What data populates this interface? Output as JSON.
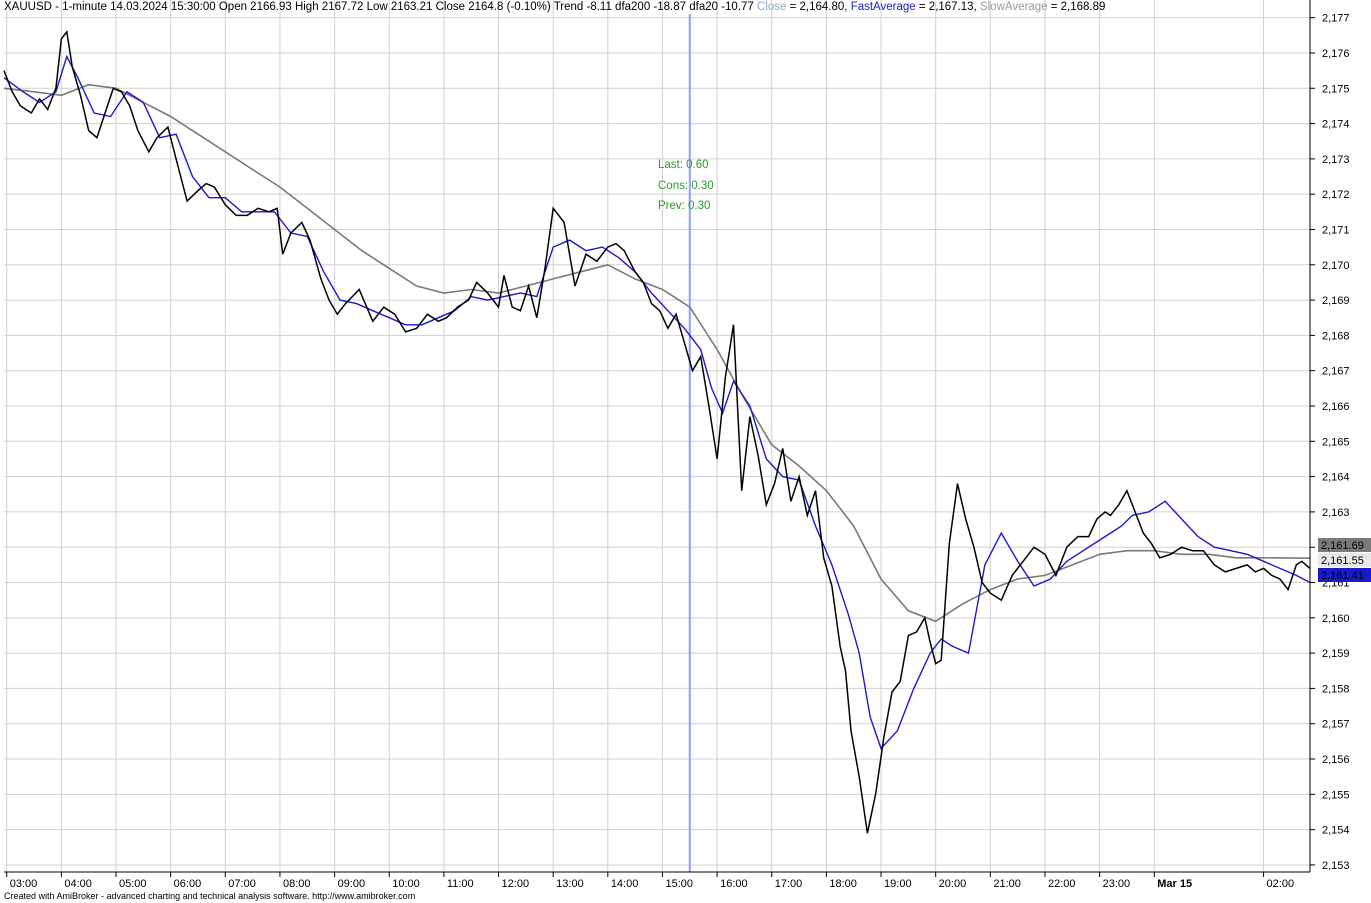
{
  "header": {
    "symbol": "XAUUSD",
    "sep": " - ",
    "timeframe": "1-minute",
    "datetime": "14.03.2024 15:30:00",
    "ohlc": "Open 2166.93 High 2167.72 Low 2163.21 Close 2164.8 (-0.10%)",
    "trend": "Trend -8.11 dfa200 -18.87 dfa20 -10.77",
    "close_label": "Close",
    "close_value": " = 2,164.80, ",
    "fast_label": "FastAverage",
    "fast_value": " = 2,167.13, ",
    "slow_label": "SlowAverage",
    "slow_value": " = 2,168.89"
  },
  "annotation": {
    "last": "Last: 0.60",
    "cons": "Cons: 0.30",
    "prev": "Prev: 0.30"
  },
  "footer": "Created with AmiBroker - advanced charting and technical analysis software. http://www.amibroker.com",
  "colors": {
    "price": "#000000",
    "fast_average": "#1a1acd",
    "slow_average": "#7a7a7a",
    "cursor": "#8f9dff",
    "grid": "#d0d0d0",
    "annotation": "#2c9a2c"
  },
  "chart_data": {
    "type": "line",
    "symbol": "XAUUSD",
    "interval": "1-minute",
    "ylim": [
      2152.8,
      2177.5
    ],
    "y_ticks": [
      2177,
      2176,
      2175,
      2174,
      2173,
      2172,
      2171,
      2170,
      2169,
      2168,
      2167,
      2166,
      2165,
      2164,
      2163,
      2162,
      2161,
      2160,
      2159,
      2158,
      2157,
      2156,
      2155,
      2154,
      2153
    ],
    "y_tick_labels": [
      "2,177",
      "2,176",
      "2,175",
      "2,174",
      "2,173",
      "2,172",
      "2,171",
      "2,170",
      "2,169",
      "2,168",
      "2,167",
      "2,166",
      "2,165",
      "2,164",
      "2,163",
      "2,162",
      "2,161",
      "2,160",
      "2,159",
      "2,158",
      "2,157",
      "2,156",
      "2,155",
      "2,154",
      "2,153"
    ],
    "x_ticks": [
      "03:00",
      "04:00",
      "05:00",
      "06:00",
      "07:00",
      "08:00",
      "09:00",
      "10:00",
      "11:00",
      "12:00",
      "13:00",
      "14:00",
      "15:00",
      "16:00",
      "17:00",
      "18:00",
      "19:00",
      "20:00",
      "21:00",
      "22:00",
      "23:00",
      "Mar 15",
      "02:00"
    ],
    "x_tick_hours": [
      3,
      4,
      5,
      6,
      7,
      8,
      9,
      10,
      11,
      12,
      13,
      14,
      15,
      16,
      17,
      18,
      19,
      20,
      21,
      22,
      23,
      24,
      26
    ],
    "x_range_hours": [
      2.95,
      26.85
    ],
    "cursor_time_hours": 15.5,
    "last_values": [
      {
        "label": "2,161.69",
        "value": 2161.69,
        "color": "#7a7a7a"
      },
      {
        "label": "2,161.55",
        "value": 2161.55,
        "color": "#e8e8e8"
      },
      {
        "label": "2,161.41",
        "value": 2161.41,
        "color": "#1a1acd"
      }
    ],
    "series": [
      {
        "name": "Close",
        "hours": [
          2.95,
          3.1,
          3.25,
          3.45,
          3.6,
          3.75,
          3.9,
          4.0,
          4.1,
          4.2,
          4.35,
          4.5,
          4.65,
          4.8,
          4.95,
          5.1,
          5.25,
          5.4,
          5.6,
          5.75,
          5.95,
          6.1,
          6.3,
          6.5,
          6.65,
          6.8,
          7.0,
          7.2,
          7.4,
          7.6,
          7.8,
          7.95,
          8.05,
          8.2,
          8.4,
          8.55,
          8.75,
          8.9,
          9.05,
          9.2,
          9.45,
          9.7,
          9.9,
          10.1,
          10.3,
          10.5,
          10.7,
          10.9,
          11.05,
          11.25,
          11.45,
          11.6,
          11.8,
          12.0,
          12.1,
          12.25,
          12.4,
          12.55,
          12.7,
          12.85,
          13.0,
          13.2,
          13.4,
          13.6,
          13.8,
          14.0,
          14.15,
          14.3,
          14.5,
          14.65,
          14.8,
          14.95,
          15.1,
          15.25,
          15.4,
          15.55,
          15.7,
          15.85,
          16.0,
          16.15,
          16.3,
          16.45,
          16.6,
          16.75,
          16.9,
          17.05,
          17.2,
          17.35,
          17.5,
          17.65,
          17.8,
          17.95,
          18.1,
          18.25,
          18.35,
          18.45,
          18.6,
          18.75,
          18.9,
          19.05,
          19.2,
          19.35,
          19.5,
          19.65,
          19.8,
          19.9,
          20.0,
          20.1,
          20.25,
          20.4,
          20.55,
          20.7,
          20.85,
          21.0,
          21.2,
          21.4,
          21.6,
          21.8,
          22.0,
          22.2,
          22.4,
          22.6,
          22.8,
          22.95,
          23.1,
          23.2,
          23.35,
          23.5,
          23.65,
          23.8,
          23.95,
          24.1,
          24.3,
          24.5,
          24.7,
          24.9,
          25.1,
          25.3,
          25.5,
          25.7,
          25.85,
          26.0,
          26.15,
          26.3,
          26.45,
          26.6,
          26.7,
          26.85
        ],
        "values": [
          2175.5,
          2174.9,
          2174.5,
          2174.3,
          2174.7,
          2174.4,
          2175.0,
          2176.4,
          2176.6,
          2175.6,
          2174.8,
          2173.8,
          2173.6,
          2174.3,
          2175.0,
          2174.9,
          2174.5,
          2173.8,
          2173.2,
          2173.6,
          2173.9,
          2173.0,
          2171.8,
          2172.1,
          2172.3,
          2172.2,
          2171.7,
          2171.4,
          2171.4,
          2171.6,
          2171.5,
          2171.6,
          2170.3,
          2170.9,
          2171.2,
          2170.7,
          2169.6,
          2169.0,
          2168.6,
          2168.9,
          2169.3,
          2168.4,
          2168.8,
          2168.6,
          2168.1,
          2168.2,
          2168.6,
          2168.4,
          2168.5,
          2168.8,
          2169.0,
          2169.5,
          2169.2,
          2168.8,
          2169.7,
          2168.8,
          2168.7,
          2169.4,
          2168.5,
          2169.9,
          2171.6,
          2171.2,
          2169.4,
          2170.3,
          2170.1,
          2170.5,
          2170.6,
          2170.4,
          2169.8,
          2169.5,
          2168.9,
          2168.7,
          2168.2,
          2168.6,
          2167.8,
          2167.0,
          2167.4,
          2166.0,
          2164.5,
          2166.8,
          2168.3,
          2163.6,
          2165.7,
          2164.6,
          2163.2,
          2163.8,
          2164.8,
          2163.3,
          2164.0,
          2162.9,
          2163.6,
          2161.7,
          2160.9,
          2159.2,
          2158.5,
          2156.8,
          2155.5,
          2153.9,
          2155.0,
          2156.6,
          2157.9,
          2158.2,
          2159.5,
          2159.6,
          2160.0,
          2159.3,
          2158.7,
          2158.8,
          2162.1,
          2163.8,
          2162.8,
          2162.0,
          2161.0,
          2160.7,
          2160.5,
          2161.2,
          2161.6,
          2162.0,
          2161.8,
          2161.2,
          2162.0,
          2162.3,
          2162.3,
          2162.8,
          2163.0,
          2162.9,
          2163.2,
          2163.6,
          2163.0,
          2162.4,
          2162.1,
          2161.7,
          2161.8,
          2162.0,
          2161.9,
          2161.9,
          2161.5,
          2161.3,
          2161.4,
          2161.5,
          2161.3,
          2161.4,
          2161.2,
          2161.1,
          2160.8,
          2161.5,
          2161.6,
          2161.4
        ]
      },
      {
        "name": "FastAverage",
        "hours": [
          2.95,
          3.3,
          3.6,
          3.9,
          4.1,
          4.3,
          4.6,
          4.9,
          5.2,
          5.5,
          5.8,
          6.1,
          6.4,
          6.7,
          7.0,
          7.3,
          7.6,
          7.9,
          8.2,
          8.5,
          8.8,
          9.1,
          9.4,
          9.7,
          10.0,
          10.3,
          10.6,
          10.9,
          11.2,
          11.5,
          11.8,
          12.1,
          12.4,
          12.7,
          13.0,
          13.3,
          13.6,
          13.9,
          14.2,
          14.5,
          14.8,
          15.1,
          15.4,
          15.7,
          15.9,
          16.1,
          16.3,
          16.6,
          16.9,
          17.2,
          17.5,
          17.8,
          18.1,
          18.4,
          18.6,
          18.8,
          19.0,
          19.3,
          19.6,
          19.9,
          20.1,
          20.3,
          20.6,
          20.9,
          21.2,
          21.5,
          21.8,
          22.1,
          22.4,
          22.7,
          23.0,
          23.2,
          23.4,
          23.6,
          23.9,
          24.2,
          24.5,
          24.8,
          25.1,
          25.4,
          25.7,
          26.0,
          26.3,
          26.6,
          26.85
        ],
        "values": [
          2175.3,
          2174.9,
          2174.6,
          2174.9,
          2175.9,
          2175.3,
          2174.3,
          2174.2,
          2174.9,
          2174.6,
          2173.6,
          2173.7,
          2172.5,
          2171.9,
          2171.9,
          2171.5,
          2171.5,
          2171.5,
          2170.9,
          2170.8,
          2169.8,
          2169.0,
          2168.9,
          2168.7,
          2168.5,
          2168.3,
          2168.3,
          2168.5,
          2168.7,
          2169.1,
          2169.0,
          2169.1,
          2169.2,
          2169.1,
          2170.5,
          2170.7,
          2170.4,
          2170.5,
          2170.2,
          2169.8,
          2169.2,
          2168.7,
          2168.2,
          2167.6,
          2166.5,
          2165.8,
          2166.7,
          2166.0,
          2164.5,
          2164.0,
          2163.9,
          2162.6,
          2161.5,
          2160.1,
          2159.0,
          2157.2,
          2156.3,
          2156.8,
          2158.0,
          2159.0,
          2159.4,
          2159.2,
          2159.0,
          2161.5,
          2162.4,
          2161.6,
          2160.9,
          2161.1,
          2161.6,
          2161.9,
          2162.2,
          2162.4,
          2162.6,
          2162.9,
          2163.0,
          2163.3,
          2162.8,
          2162.3,
          2162.0,
          2161.9,
          2161.8,
          2161.6,
          2161.4,
          2161.2,
          2161.0,
          2161.41
        ]
      },
      {
        "name": "SlowAverage",
        "hours": [
          2.95,
          3.5,
          4.0,
          4.5,
          5.0,
          5.5,
          6.0,
          6.5,
          7.0,
          7.5,
          8.0,
          8.5,
          9.0,
          9.5,
          10.0,
          10.5,
          11.0,
          11.5,
          12.0,
          12.5,
          13.0,
          13.5,
          14.0,
          14.5,
          15.0,
          15.5,
          16.0,
          16.5,
          17.0,
          17.5,
          18.0,
          18.5,
          19.0,
          19.5,
          20.0,
          20.5,
          21.0,
          21.5,
          22.0,
          22.5,
          23.0,
          23.5,
          24.0,
          24.5,
          25.0,
          25.5,
          26.0,
          26.85
        ],
        "values": [
          2175.0,
          2174.9,
          2174.8,
          2175.1,
          2175.0,
          2174.6,
          2174.2,
          2173.7,
          2173.2,
          2172.7,
          2172.2,
          2171.6,
          2171.0,
          2170.4,
          2169.9,
          2169.4,
          2169.2,
          2169.3,
          2169.2,
          2169.4,
          2169.6,
          2169.8,
          2170.0,
          2169.6,
          2169.3,
          2168.8,
          2167.6,
          2166.2,
          2164.9,
          2164.3,
          2163.6,
          2162.6,
          2161.1,
          2160.2,
          2159.9,
          2160.4,
          2160.8,
          2161.1,
          2161.2,
          2161.5,
          2161.8,
          2161.9,
          2161.9,
          2161.8,
          2161.8,
          2161.7,
          2161.7,
          2161.69
        ]
      }
    ]
  }
}
